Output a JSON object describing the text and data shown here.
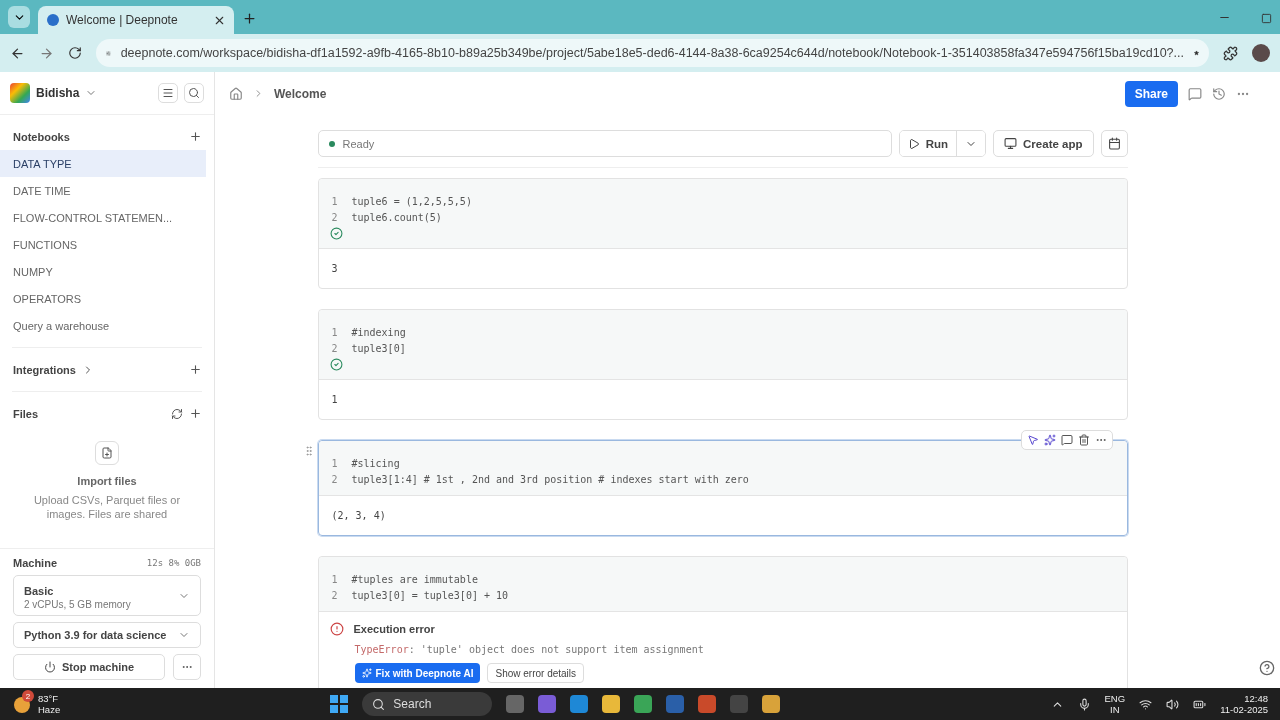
{
  "browser": {
    "tab_title": "Welcome | Deepnote",
    "url": "deepnote.com/workspace/bidisha-df1a1592-a9fb-4165-8b10-b89a25b349be/project/5abe18e5-ded6-4144-8a38-6ca9254c644d/notebook/Notebook-1-351403858fa347e594756f15ba19cd10?..."
  },
  "header": {
    "workspace": "Bidisha",
    "breadcrumb": "Welcome",
    "share": "Share"
  },
  "sidebar": {
    "notebooks_title": "Notebooks",
    "notebooks": [
      {
        "label": "DATA TYPE",
        "selected": true
      },
      {
        "label": "DATE TIME",
        "selected": false
      },
      {
        "label": "FLOW-CONTROL STATEMEN...",
        "selected": false
      },
      {
        "label": "FUNCTIONS",
        "selected": false
      },
      {
        "label": "NUMPY",
        "selected": false
      },
      {
        "label": "OPERATORS",
        "selected": false
      },
      {
        "label": "Query a warehouse",
        "selected": false
      }
    ],
    "integrations": "Integrations",
    "files": "Files",
    "import_title": "Import files",
    "import_text": "Upload CSVs, Parquet files or images. Files are shared",
    "machine": {
      "title": "Machine",
      "stats": "12s 8% 0GB",
      "tier": "Basic",
      "tier_detail": "2 vCPUs, 5 GB memory",
      "environment": "Python 3.9 for data science",
      "stop": "Stop machine"
    }
  },
  "toolbar": {
    "status": "Ready",
    "run": "Run",
    "create_app": "Create app"
  },
  "cells": [
    {
      "lines": [
        {
          "number": "1",
          "code": "tuple6 = (1,2,5,5,5)"
        },
        {
          "number": "2",
          "code": "tuple6.count(5)"
        }
      ],
      "ran_ok": true,
      "focused": false,
      "output": {
        "kind": "text",
        "text": "3"
      }
    },
    {
      "lines": [
        {
          "number": "1",
          "code": "#indexing"
        },
        {
          "number": "2",
          "code": "tuple3[0]"
        }
      ],
      "ran_ok": true,
      "focused": false,
      "output": {
        "kind": "text",
        "text": "1"
      }
    },
    {
      "lines": [
        {
          "number": "1",
          "code": "#slicing"
        },
        {
          "number": "2",
          "code": "tuple3[1:4] # 1st , 2nd and 3rd position # indexes start with zero"
        }
      ],
      "ran_ok": false,
      "focused": true,
      "output": {
        "kind": "text",
        "text": "(2, 3, 4)"
      }
    },
    {
      "lines": [
        {
          "number": "1",
          "code": "#tuples are immutable"
        },
        {
          "number": "2",
          "code": "tuple3[0] = tuple3[0] + 10"
        }
      ],
      "ran_ok": false,
      "focused": false,
      "output": {
        "kind": "error",
        "title": "Execution error",
        "error_type": "TypeError",
        "message": ": 'tuple' object does not support item assignment",
        "fix": "Fix with Deepnote AI",
        "details": "Show error details"
      }
    }
  ],
  "taskbar": {
    "badge": "2",
    "temperature": "83°F",
    "weather": "Haze",
    "search": "Search",
    "language": "ENG",
    "region": "IN",
    "time": "12:48",
    "date": "11-02-2025"
  }
}
